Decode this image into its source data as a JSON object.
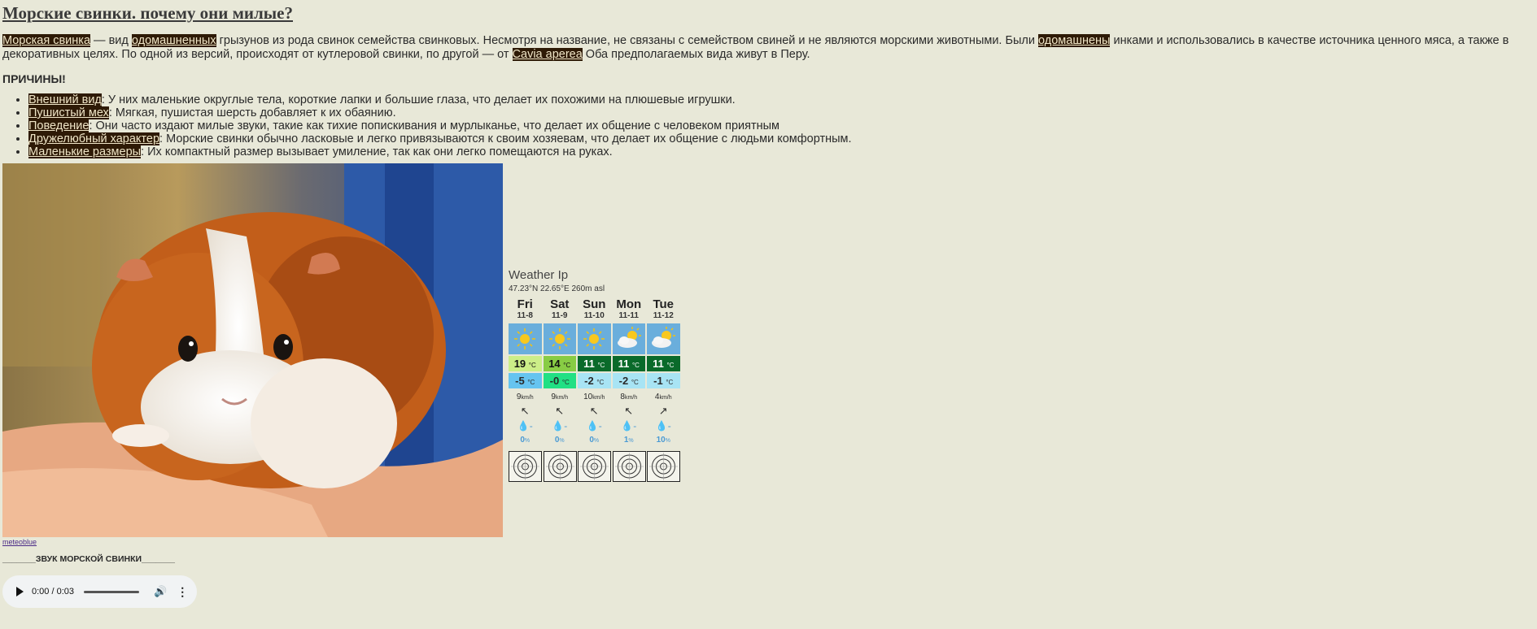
{
  "article": {
    "title": "Морские свинки. почему они милые?",
    "intro": {
      "hl1": "Морская свинка",
      "t1": " — вид ",
      "hl2": "одомашненных",
      "t2": " грызунов из рода свинок семейства свинковых. Несмотря на название, не связаны с семейством свиней и не являются морскими животными. Были ",
      "hl3": "одомашнены",
      "t3": " инками и использовались в качестве источника ценного мяса, а также в декоративных целях. По одной из версий, происходят от кутлеровой свинки, по другой — от ",
      "hl4": "Cavia aperea",
      "t4": " Оба предполагаемых вида живут в Перу."
    },
    "reasons_heading": "ПРИЧИНЫ!",
    "reasons": [
      {
        "term": "Внешний вид",
        "text": ": У них маленькие округлые тела, короткие лапки и большие глаза, что делает их похожими на плюшевые игрушки."
      },
      {
        "term": "Пушистый мех",
        "text": ": Мягкая, пушистая шерсть добавляет к их обаянию."
      },
      {
        "term": "Поведение",
        "text": ": Они часто издают милые звуки, такие как тихие попискивания и мурлыканье, что делает их общение с человеком приятным"
      },
      {
        "term": "Дружелюбный характер",
        "text": ": Морские свинки обычно ласковые и легко привязываются к своим хозяевам, что делает их общение с людьми комфортным."
      },
      {
        "term": "Маленькие размеры",
        "text": ": Их компактный размер вызывает умиление, так как они легко помещаются на руках."
      }
    ]
  },
  "weather": {
    "title": "Weather Ip",
    "coords": "47.23°N 22.65°E 260m asl",
    "temp_unit": "°C",
    "wind_unit": "km/h",
    "prob_unit": "%",
    "days": [
      {
        "day": "Fri",
        "date": "11-8",
        "icon": "sun-icon",
        "max": "19",
        "min": "-5",
        "max_color": "#ccee88",
        "min_color": "#66c4f0",
        "wind": "9",
        "arrow": "↖",
        "precip": "-",
        "prob": "0"
      },
      {
        "day": "Sat",
        "date": "11-9",
        "icon": "sun-icon",
        "max": "14",
        "min": "-0",
        "max_color": "#88cc44",
        "min_color": "#22e084",
        "wind": "9",
        "arrow": "↖",
        "precip": "-",
        "prob": "0"
      },
      {
        "day": "Sun",
        "date": "11-10",
        "icon": "sun-icon",
        "max": "11",
        "min": "-2",
        "max_color": "#0a6a2a",
        "min_color": "#a8e4f4",
        "wind": "10",
        "arrow": "↖",
        "precip": "-",
        "prob": "0"
      },
      {
        "day": "Mon",
        "date": "11-11",
        "icon": "sun-cloud-icon",
        "max": "11",
        "min": "-2",
        "max_color": "#0a6a2a",
        "min_color": "#a8e4f4",
        "wind": "8",
        "arrow": "↖",
        "precip": "-",
        "prob": "1"
      },
      {
        "day": "Tue",
        "date": "11-12",
        "icon": "sun-cloud-icon",
        "max": "11",
        "min": "-1",
        "max_color": "#0a6a2a",
        "min_color": "#a8e4f4",
        "wind": "4",
        "arrow": "↗",
        "precip": "-",
        "prob": "10"
      }
    ]
  },
  "credit": "meteoblue",
  "sound_label": "_______ЗВУК МОРСКОЙ СВИНКИ_______",
  "audio": {
    "time": "0:00 / 0:03"
  }
}
